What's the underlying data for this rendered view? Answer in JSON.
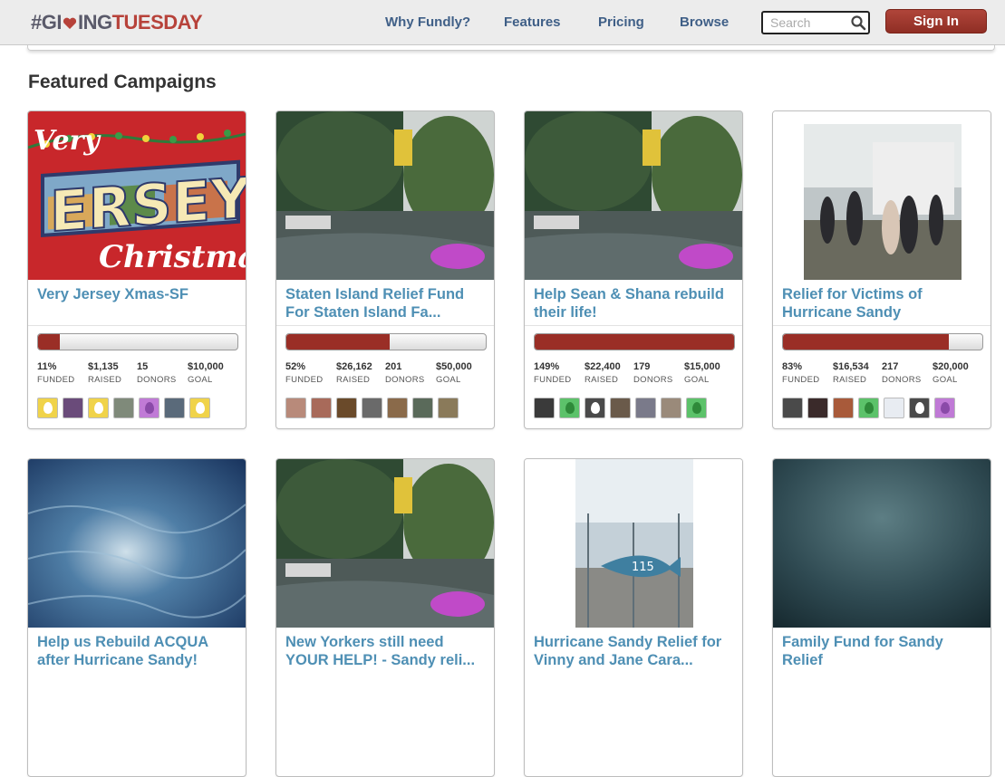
{
  "header": {
    "logo": {
      "hash": "#",
      "give": "GI",
      "give2": "ING",
      "tues": "TUESDAY"
    },
    "nav": [
      "Why Fundly?",
      "Features",
      "Pricing",
      "Browse"
    ],
    "search_placeholder": "Search",
    "signin_label": "Sign In"
  },
  "main": {
    "section_title": "Featured Campaigns",
    "stat_labels": [
      "FUNDED",
      "RAISED",
      "DONORS",
      "GOAL"
    ],
    "campaigns": [
      {
        "title_line1": "Very Jersey Xmas-SF",
        "title_line2": "",
        "funded": "11%",
        "raised": "$1,135",
        "donors": "15",
        "goal": "$10,000",
        "progress": 0.11,
        "image": "jersey-postcard"
      },
      {
        "title_line1": "Staten Island Relief Fund",
        "title_line2": "For Staten Island Fa...",
        "funded": "52%",
        "raised": "$26,162",
        "donors": "201",
        "goal": "$50,000",
        "progress": 0.52,
        "image": "flooded-yard"
      },
      {
        "title_line1": "Help Sean & Shana rebuild",
        "title_line2": "their life!",
        "funded": "149%",
        "raised": "$22,400",
        "donors": "179",
        "goal": "$15,000",
        "progress": 1.0,
        "image": "flooded-yard"
      },
      {
        "title_line1": "Relief for Victims of",
        "title_line2": "Hurricane Sandy",
        "funded": "83%",
        "raised": "$16,534",
        "donors": "217",
        "goal": "$20,000",
        "progress": 0.83,
        "image": "relief-truck"
      },
      {
        "title_line1": "Help us Rebuild ACQUA",
        "title_line2": "after Hurricane Sandy!",
        "image": "ocean-waves"
      },
      {
        "title_line1": "New Yorkers still need",
        "title_line2": "YOUR HELP! - Sandy reli...",
        "image": "flooded-yard"
      },
      {
        "title_line1": "Hurricane Sandy Relief for",
        "title_line2": "Vinny and Jane Cara...",
        "image": "fence-115"
      },
      {
        "title_line1": "Family Fund for Sandy",
        "title_line2": "Relief",
        "image": "dark-teal"
      }
    ]
  },
  "colors": {
    "brand_red": "#9a2e26",
    "link_blue": "#4e8fb4",
    "nav_blue": "#3f5f87"
  }
}
